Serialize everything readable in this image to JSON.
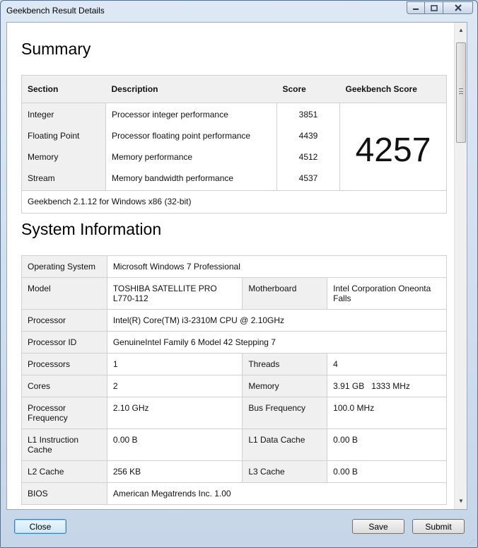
{
  "window": {
    "title": "Geekbench Result Details"
  },
  "summary": {
    "title": "Summary",
    "headers": {
      "section": "Section",
      "description": "Description",
      "score": "Score",
      "geekbench_score": "Geekbench Score"
    },
    "rows": [
      {
        "section": "Integer",
        "description": "Processor integer performance",
        "score": "3851"
      },
      {
        "section": "Floating Point",
        "description": "Processor floating point performance",
        "score": "4439"
      },
      {
        "section": "Memory",
        "description": "Memory performance",
        "score": "4512"
      },
      {
        "section": "Stream",
        "description": "Memory bandwidth performance",
        "score": "4537"
      }
    ],
    "overall": "4257",
    "version": "Geekbench 2.1.12 for Windows x86 (32-bit)"
  },
  "system": {
    "title": "System Information",
    "os_label": "Operating System",
    "os": "Microsoft Windows 7 Professional",
    "model_label": "Model",
    "model": "TOSHIBA SATELLITE PRO L770-112",
    "motherboard_label": "Motherboard",
    "motherboard": "Intel Corporation Oneonta Falls",
    "processor_label": "Processor",
    "processor": "Intel(R) Core(TM) i3-2310M CPU @ 2.10GHz",
    "processor_id_label": "Processor ID",
    "processor_id": "GenuineIntel Family 6 Model 42 Stepping 7",
    "processors_label": "Processors",
    "processors": "1",
    "threads_label": "Threads",
    "threads": "4",
    "cores_label": "Cores",
    "cores": "2",
    "memory_label": "Memory",
    "memory": "3.91 GB   1333 MHz",
    "proc_freq_label": "Processor Frequency",
    "proc_freq": "2.10 GHz",
    "bus_freq_label": "Bus Frequency",
    "bus_freq": "100.0 MHz",
    "l1i_label": "L1 Instruction Cache",
    "l1i": "0.00 B",
    "l1d_label": "L1 Data Cache",
    "l1d": "0.00 B",
    "l2_label": "L2 Cache",
    "l2": "256 KB",
    "l3_label": "L3 Cache",
    "l3": "0.00 B",
    "bios_label": "BIOS",
    "bios": "American Megatrends Inc. 1.00"
  },
  "buttons": {
    "close": "Close",
    "save": "Save",
    "submit": "Submit"
  },
  "icons": {
    "minimize": "minimize-icon",
    "maximize": "maximize-icon",
    "close": "close-icon"
  }
}
